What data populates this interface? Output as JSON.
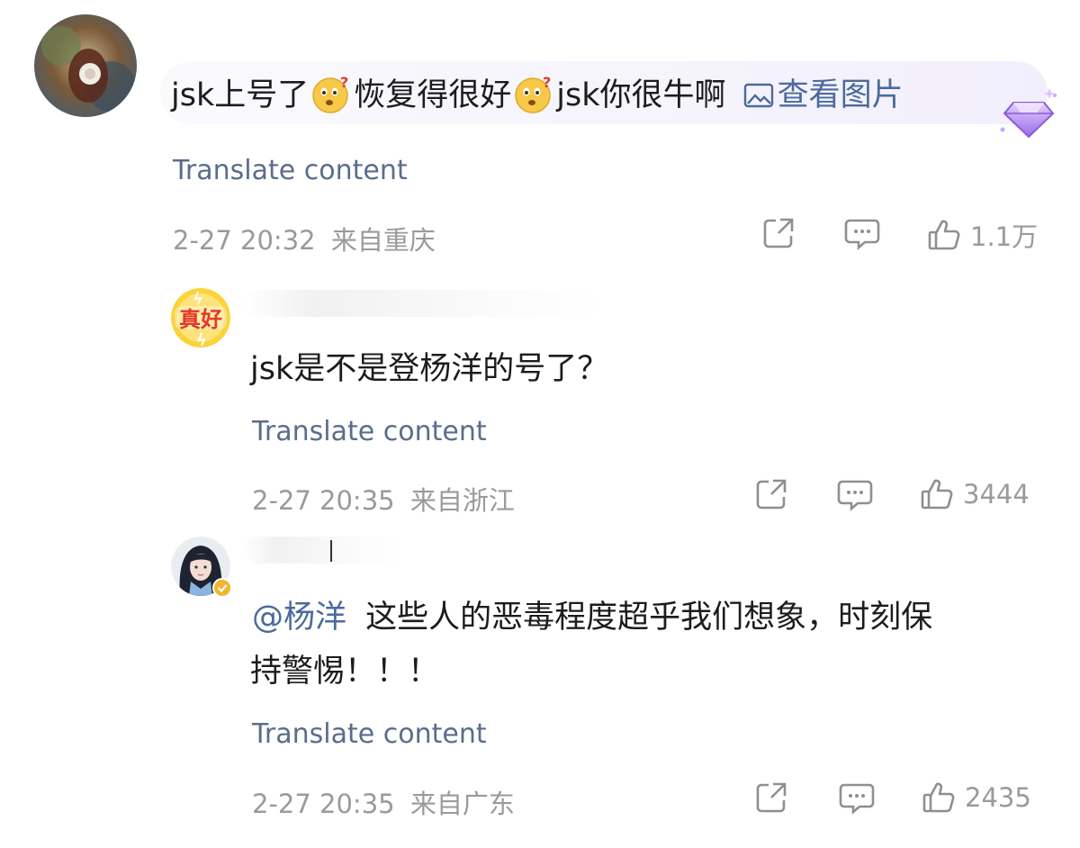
{
  "comments": [
    {
      "id": "c1",
      "text_parts": [
        "jsk上号了",
        "恢复得很好",
        "jsk你很牛啊"
      ],
      "view_pic_label": "查看图片",
      "translate_label": "Translate content",
      "timestamp": "2-27 20:32",
      "location": "来自重庆",
      "like_count": "1.1万",
      "emoji_name": "thinking-face-emoji",
      "avatar_icon": "avatar-photo"
    },
    {
      "id": "c2",
      "text": "jsk是不是登杨洋的号了？",
      "translate_label": "Translate content",
      "timestamp": "2-27 20:35",
      "location": "来自浙江",
      "like_count": "3444",
      "avatar_badge_text": "真好"
    },
    {
      "id": "c3",
      "mention": "@杨洋",
      "text_line1": "这些人的恶毒程度超乎我们想象，时刻保",
      "text_line2": "持警惕！！！",
      "translate_label": "Translate content",
      "timestamp": "2-27 20:35",
      "location": "来自广东",
      "like_count": "2435"
    }
  ],
  "colors": {
    "link": "#4b6a9b",
    "meta": "#9a9a9a",
    "text": "#1c1c1c",
    "highlight": "#f2effc",
    "badge_purple": "#b48cf0"
  }
}
